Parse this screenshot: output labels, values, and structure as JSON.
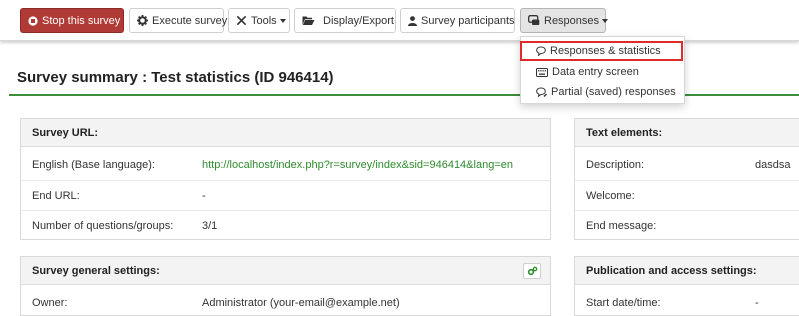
{
  "toolbar": {
    "stop_label": "Stop this survey",
    "execute_label": "Execute survey",
    "tools_label": "Tools",
    "display_label": "Display/Export",
    "participants_label": "Survey participants",
    "responses_label": "Responses"
  },
  "responses_menu": {
    "items": [
      {
        "label": "Responses & statistics",
        "icon": "speech-bubble-icon",
        "highlighted": true
      },
      {
        "label": "Data entry screen",
        "icon": "keyboard-icon",
        "highlighted": false
      },
      {
        "label": "Partial (saved) responses",
        "icon": "speech-bubble-edit-icon",
        "highlighted": false
      }
    ]
  },
  "page": {
    "title": "Survey summary : Test statistics (ID 946414)"
  },
  "survey_url_panel": {
    "title": "Survey URL:",
    "rows": [
      {
        "label": "English (Base language):",
        "value": "http://localhost/index.php?r=survey/index&sid=946414&lang=en"
      },
      {
        "label": "End URL:",
        "value": "-"
      },
      {
        "label": "Number of questions/groups:",
        "value": "3/1"
      }
    ]
  },
  "text_elements_panel": {
    "title": "Text elements:",
    "rows": [
      {
        "label": "Description:",
        "value": "dasdsa"
      },
      {
        "label": "Welcome:",
        "value": ""
      },
      {
        "label": "End message:",
        "value": ""
      }
    ]
  },
  "general_settings_panel": {
    "title": "Survey general settings:",
    "rows": [
      {
        "label": "Owner:",
        "value": "Administrator (your-email@example.net)"
      }
    ]
  },
  "publication_panel": {
    "title": "Publication and access settings:",
    "rows": [
      {
        "label": "Start date/time:",
        "value": "-"
      }
    ]
  },
  "colors": {
    "danger": "#b03a35",
    "accent_green": "#3b8e3b",
    "link_green": "#2e8b2e",
    "highlight_red": "#e02b2b"
  }
}
